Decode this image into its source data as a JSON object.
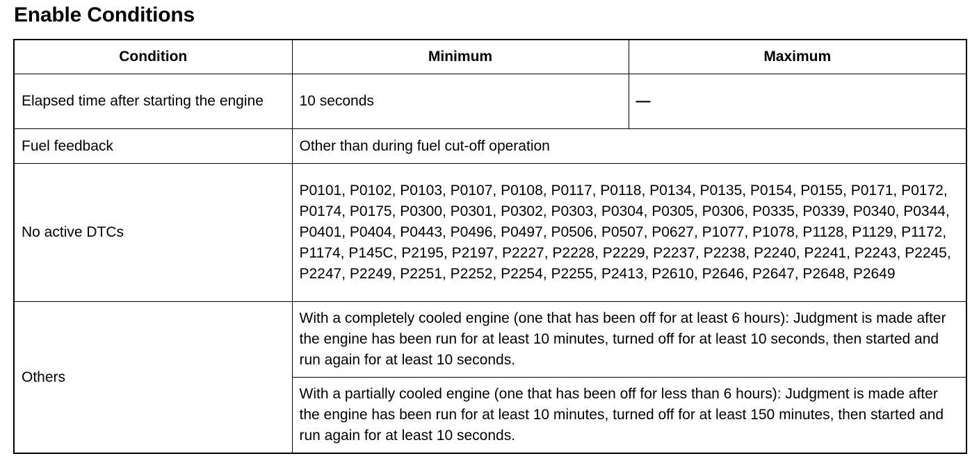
{
  "title": "Enable Conditions",
  "table": {
    "headers": {
      "condition": "Condition",
      "minimum": "Minimum",
      "maximum": "Maximum"
    },
    "rows": {
      "elapsed": {
        "condition": "Elapsed time after starting the engine",
        "minimum": "10 seconds",
        "maximum": "—"
      },
      "fuel": {
        "condition": "Fuel feedback",
        "value": "Other than during fuel cut-off operation"
      },
      "dtc": {
        "condition": "No active DTCs",
        "value": "P0101, P0102, P0103, P0107, P0108, P0117, P0118, P0134, P0135, P0154, P0155, P0171, P0172, P0174, P0175, P0300, P0301, P0302, P0303, P0304, P0305, P0306, P0335, P0339, P0340, P0344, P0401, P0404, P0443, P0496, P0497, P0506, P0507, P0627, P1077, P1078, P1128, P1129, P1172, P1174, P145C, P2195, P2197, P2227, P2228, P2229, P2237, P2238, P2240, P2241, P2243, P2245, P2247, P2249, P2251, P2252, P2254, P2255, P2413, P2610, P2646, P2647, P2648, P2649"
      },
      "others": {
        "condition": "Others",
        "values": [
          "With a completely cooled engine (one that has been off for at least 6 hours): Judgment is made after the engine has been run for at least 10 minutes, turned off for at least 10 seconds, then started and run again for at least 10 seconds.",
          "With a partially cooled engine (one that has been off for less than 6 hours): Judgment is made after the engine has been run for at least 10 minutes, turned off for at least 150 minutes, then started and run again for at least 10 seconds."
        ]
      }
    }
  }
}
